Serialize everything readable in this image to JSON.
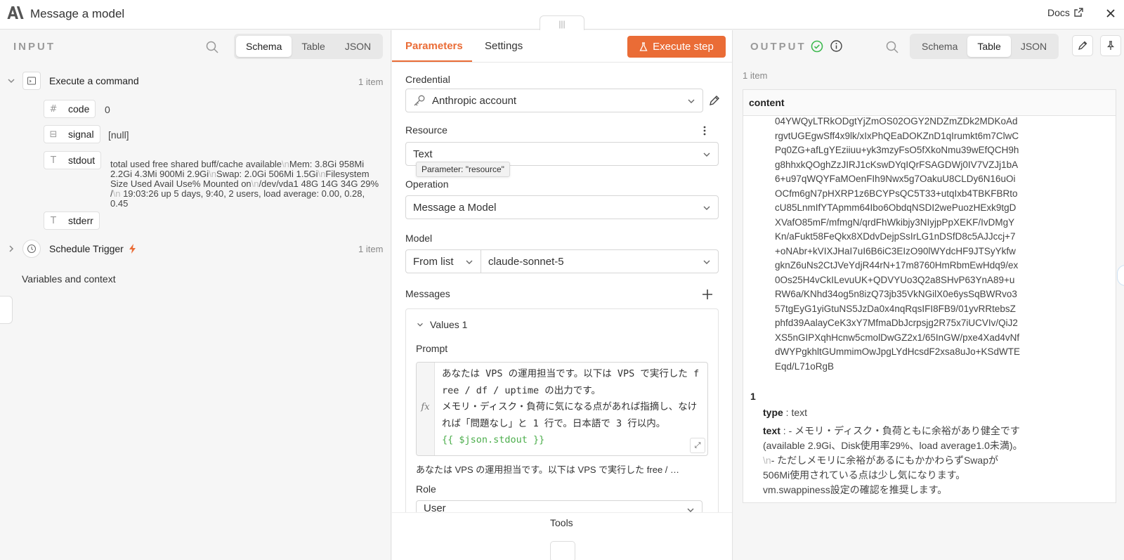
{
  "header": {
    "title": "Message a model",
    "docs_label": "Docs"
  },
  "input": {
    "label": "INPUT",
    "tabs": [
      "Schema",
      "Table",
      "JSON"
    ],
    "nodes": [
      {
        "name": "Execute a command",
        "count": "1 item",
        "fields": [
          {
            "name": "code",
            "value": "0"
          },
          {
            "name": "signal",
            "value": "[null]"
          },
          {
            "name": "stdout",
            "value_parts": [
              "total used free shared buff/cache available",
              "Mem: 3.8Gi 958Mi 2.2Gi 4.3Mi 900Mi 2.9Gi",
              "Swap: 2.0Gi 506Mi 1.5Gi",
              "Filesystem Size Used Avail Use% Mounted on",
              "/dev/vda1 48G 14G 34G 29% /",
              " 19:03:26 up 5 days, 9:40, 2 users, load average: 0.00, 0.28, 0.45"
            ]
          },
          {
            "name": "stderr",
            "value": ""
          }
        ]
      },
      {
        "name": "Schedule Trigger",
        "count": "1 item"
      }
    ],
    "variables_label": "Variables and context"
  },
  "params": {
    "tabs": [
      "Parameters",
      "Settings"
    ],
    "execute_label": "Execute step",
    "credential_label": "Credential",
    "credential_value": "Anthropic account",
    "resource_label": "Resource",
    "resource_value": "Text",
    "resource_tooltip": "Parameter: \"resource\"",
    "operation_label": "Operation",
    "operation_value": "Message a Model",
    "model_label": "Model",
    "model_mode": "From list",
    "model_value": "claude-sonnet-5",
    "messages_label": "Messages",
    "values_label": "Values 1",
    "prompt_label": "Prompt",
    "prompt_text": "あなたは VPS の運用担当です。以下は VPS で実行した free / df / uptime の出力です。\nメモリ・ディスク・負荷に気になる点があれば指摘し、なければ「問題なし」と 1 行で。日本語で 3 行以内。\n",
    "prompt_expr": "{{ $json.stdout }}",
    "prompt_preview": "あなたは VPS の運用担当です。以下は VPS で実行した free / …",
    "role_label": "Role",
    "role_value": "User",
    "tools_label": "Tools"
  },
  "output": {
    "label": "OUTPUT",
    "tabs": [
      "Schema",
      "Table",
      "JSON"
    ],
    "active_tab": "Table",
    "items_count": "1 item",
    "column": "content",
    "b64_text": "04YWQyLTRkODgtYjZmOS02OGY2NDZmZDk2MDKoAdrgvtUGEgwSff4x9lk/xIxPhQEaDOKZnD1qIrumkt6m7ClwCPq0ZG+afLgYEziiuu+yk3mzyFsO5fXkoNmu39wEfQCH9hg8hhxkQOghZzJIRJ1cKswDYqIQrFSAGDWj0IV7VZJj1bA6+u97qWQYFaMOenFIh9Nwx5g7OakuU8CLDy6N16uOiOCfm6gN7pHXRP1z6BCYPsQC5T33+utqIxb4TBKFBRtocU85LnmIfYTApmm64Ibo6ObdqNSDI2wePuozHExk9tgDXVafO85mF/mfmgN/qrdFhWkibjy3NIyjpPpXEKF/IvDMgYKn/aFukt58FeQkx8XDdvDejpSsIrLG1nDSfD8c5AJJccj+7+oNAbr+kVIXJHaI7uI6B6iC3EIzO90lWYdcHF9JTSyYkfwgknZ6uNs2CtJVeYdjR44rN+17m8760HmRbmEwHdq9/ex0Os25H4vCkILevuUK+QDVYUo3Q2a8SHvP63YnA89+uRW6a/KNhd34og5n8izQ73jb35VkNGilX0e6ysSqBWRvo357tgEyG1yiGtuNS5JzDa0x4nqRqsIFI8FB9/01yvRRtebsZphfd39AalayCeK3xY7MfmaDbJcrpsjg2R75x7iUCVIv/QiJ2XS5nGIPXqhHcnw5cmolDwGZ2x1/65InGW/pxe4Xad4vNfdWYPgkhltGUmmimOwJpgLYdHcsdF2xsa8uJo+KSdWTEEqd/L71oRgB",
    "row_index": "1",
    "type_key": "type",
    "type_value": "text",
    "text_key": "text",
    "text_parts": [
      "- メモリ・ディスク・負荷ともに余裕があり健全です(available 2.9Gi、Disk使用率29%、load average1.0未満)。",
      "- ただしメモリに余裕があるにもかかわらずSwapが506Mi使用されている点は少し気になります。vm.swappiness設定の確認を推奨します。"
    ]
  },
  "colors": {
    "accent": "#ea6c36",
    "success": "#3fb950",
    "text": "#333333"
  }
}
